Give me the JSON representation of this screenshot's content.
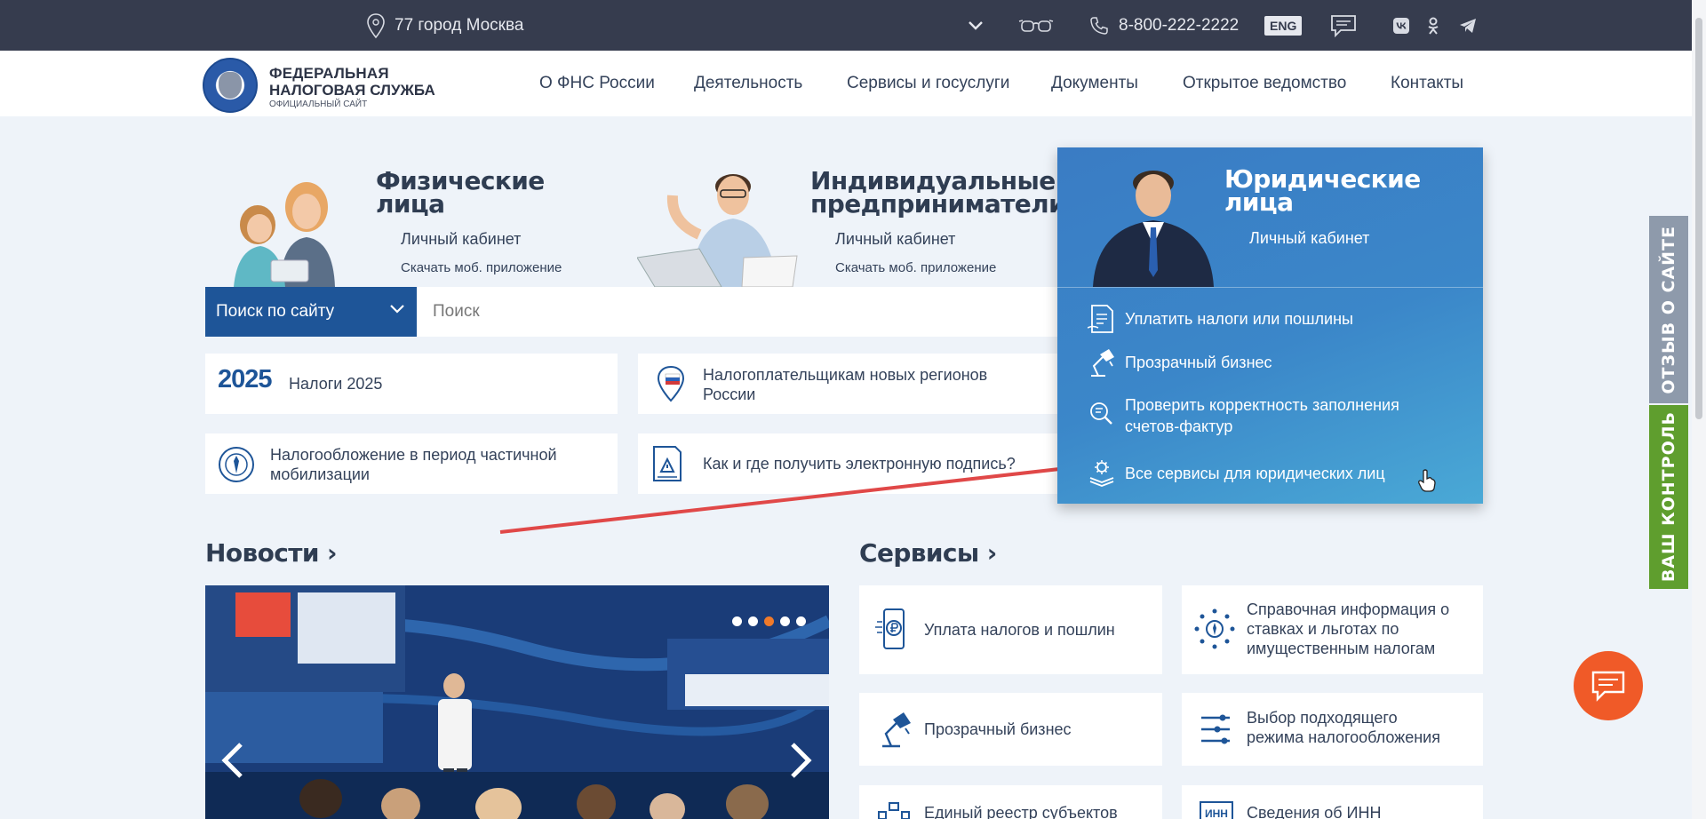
{
  "topbar": {
    "region": "77 город Москва",
    "phone": "8-800-222-2222",
    "lang": "ENG"
  },
  "header": {
    "logo_line1": "ФЕДЕРАЛЬНАЯ",
    "logo_line2": "НАЛОГОВАЯ СЛУЖБА",
    "logo_line3": "ОФИЦИАЛЬНЫЙ САЙТ",
    "nav": [
      "О ФНС России",
      "Деятельность",
      "Сервисы и госуслуги",
      "Документы",
      "Открытое ведомство",
      "Контакты"
    ]
  },
  "hero": {
    "individuals": {
      "title1": "Физические",
      "title2": "лица",
      "cabinet": "Личный кабинет",
      "app": "Скачать моб. приложение"
    },
    "entrepreneurs": {
      "title1": "Индивидуальные",
      "title2": "предприниматели",
      "cabinet": "Личный кабинет",
      "app": "Скачать моб. приложение"
    },
    "legal": {
      "title1": "Юридические",
      "title2": "лица",
      "cabinet": "Личный кабинет"
    }
  },
  "search": {
    "scope": "Поиск по сайту",
    "placeholder": "Поиск"
  },
  "quick_links": {
    "taxes_logo": "2025",
    "taxes": "Налоги 2025",
    "new_regions_1": "Налогоплательщикам новых регионов",
    "new_regions_2": "России",
    "mobilization_1": "Налогообложение в период частичной",
    "mobilization_2": "мобилизации",
    "signature": "Как и где получить электронную подпись?"
  },
  "legal_menu": {
    "items": [
      "Уплатить налоги или пошлины",
      "Прозрачный бизнес",
      "Проверить корректность заполнения",
      "счетов-фактур",
      "Все сервисы для юридических лиц"
    ]
  },
  "news": {
    "title": "Новости ›"
  },
  "services": {
    "title": "Сервисы ›",
    "pay": "Уплата налогов и пошлин",
    "ref_1": "Справочная информация о",
    "ref_2": "ставках и льготах по",
    "ref_3": "имущественным налогам",
    "transparent": "Прозрачный бизнес",
    "regime_1": "Выбор подходящего",
    "regime_2": "режима налогообложения",
    "registry": "Единый реестр субъектов",
    "inn_badge": "ИНН",
    "inn": "Сведения об ИНН"
  },
  "side_tabs": {
    "feedback": "ОТЗЫВ О САЙТЕ",
    "control": "ВАШ КОНТРОЛЬ"
  },
  "slider": {
    "active_dot": 3,
    "total_dots": 5
  }
}
